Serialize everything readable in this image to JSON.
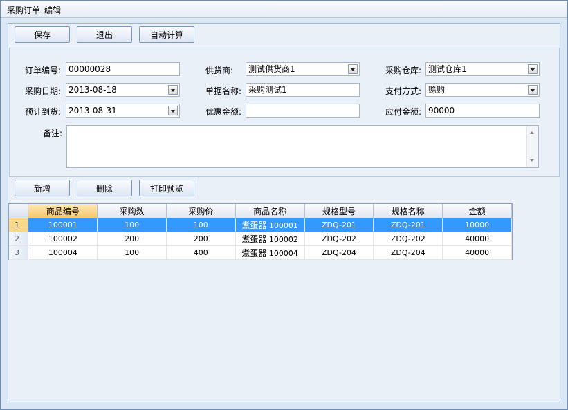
{
  "window": {
    "title": "采购订单_编辑"
  },
  "toolbar_top": {
    "save": "保存",
    "exit": "退出",
    "auto_calc": "自动计算"
  },
  "form": {
    "order_no": {
      "label": "订单编号:",
      "value": "00000028"
    },
    "purchase_date": {
      "label": "采购日期:",
      "value": "2013-08-18"
    },
    "expected_arrival": {
      "label": "预计到货:",
      "value": "2013-08-31"
    },
    "supplier": {
      "label": "供货商:",
      "value": "测试供货商1"
    },
    "doc_name": {
      "label": "单据名称:",
      "value": "采购测试1"
    },
    "discount": {
      "label": "优惠金额:",
      "value": ""
    },
    "warehouse": {
      "label": "采购仓库:",
      "value": "测试仓库1"
    },
    "payment_method": {
      "label": "支付方式:",
      "value": "赊购"
    },
    "payable": {
      "label": "应付金额:",
      "value": "90000"
    },
    "remark": {
      "label": "备注:",
      "value": ""
    }
  },
  "toolbar_grid": {
    "add": "新增",
    "delete": "删除",
    "print_preview": "打印预览"
  },
  "grid": {
    "columns": [
      "商品编号",
      "采购数",
      "采购价",
      "商品名称",
      "规格型号",
      "规格名称",
      "金额"
    ],
    "rows": [
      {
        "rn": "1",
        "code": "100001",
        "qty": "100",
        "price": "100",
        "name_cn": "煮蛋器",
        "name_code": "100001",
        "model": "ZDQ-201",
        "spec": "ZDQ-201",
        "amount": "10000"
      },
      {
        "rn": "2",
        "code": "100002",
        "qty": "200",
        "price": "200",
        "name_cn": "煮蛋器",
        "name_code": "100002",
        "model": "ZDQ-202",
        "spec": "ZDQ-202",
        "amount": "40000"
      },
      {
        "rn": "3",
        "code": "100004",
        "qty": "100",
        "price": "400",
        "name_cn": "煮蛋器",
        "name_code": "100004",
        "model": "ZDQ-204",
        "spec": "ZDQ-204",
        "amount": "40000"
      }
    ]
  }
}
